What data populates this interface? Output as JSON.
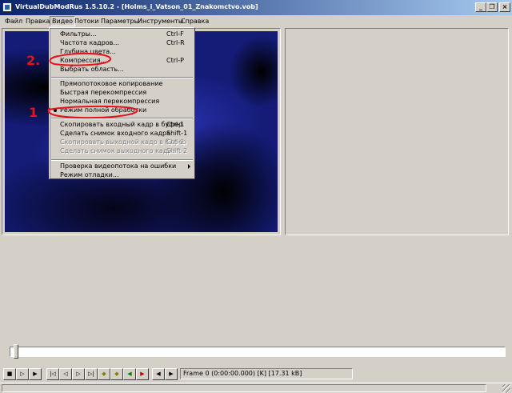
{
  "window": {
    "title": "VirtualDubModRus 1.5.10.2 - [Holms_i_Vatson_01_Znakomctvo.vob]",
    "minimize_glyph": "_",
    "restore_glyph": "❐",
    "close_glyph": "×"
  },
  "menubar": [
    "Файл",
    "Правка",
    "Видео",
    "Потоки",
    "Параметры",
    "Инструменты",
    "Справка"
  ],
  "video_menu": {
    "filters": {
      "label": "Фильтры...",
      "shortcut": "Ctrl-F"
    },
    "frame_rate": {
      "label": "Частота кадров...",
      "shortcut": "Ctrl-R"
    },
    "color_depth": {
      "label": "Глубина цвета..."
    },
    "compression": {
      "label": "Компрессия...",
      "shortcut": "Ctrl-P"
    },
    "select_range": {
      "label": "Выбрать область..."
    },
    "direct_copy": {
      "label": "Прямопотоковое копирование"
    },
    "fast_recompress": {
      "label": "Быстрая перекомпрессия"
    },
    "normal_recompress": {
      "label": "Нормальная перекомпрессия"
    },
    "full_processing": {
      "label": "Режим полной обработки",
      "checked": true
    },
    "copy_source_frame": {
      "label": "Скопировать входный кадр в буфер",
      "shortcut": "Ctrl-1"
    },
    "snapshot_source_frame": {
      "label": "Сделать снимок входного кадра",
      "shortcut": "Shift-1"
    },
    "copy_output_frame": {
      "label": "Скопировать выходной кадр в буфер",
      "shortcut": "Ctrl-2"
    },
    "snapshot_output_frame": {
      "label": "Сделать снимок выходного кадра",
      "shortcut": "Shift-2"
    },
    "scan_errors": {
      "label": "Проверка видеопотока на ошибки"
    },
    "debug_mode": {
      "label": "Режим отладки..."
    }
  },
  "annotations": {
    "mark_1": "1",
    "mark_2": "2."
  },
  "status": {
    "frame": "Frame 0 (0:00:00.000) [K] [17.31 kB]"
  },
  "colors": {
    "annotation": "#e8101a",
    "title_start": "#0a246a",
    "title_end": "#a6caf0",
    "face": "#d4d0c8"
  }
}
